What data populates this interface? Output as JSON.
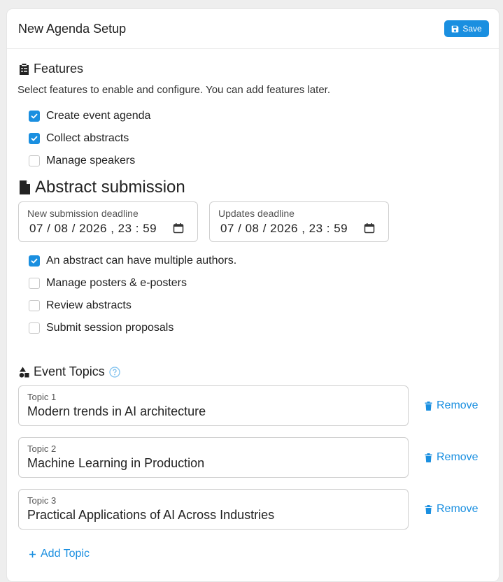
{
  "header": {
    "title": "New Agenda Setup",
    "save_label": "Save"
  },
  "features": {
    "title": "Features",
    "description": "Select features to enable and configure. You can add features later.",
    "options": [
      {
        "label": "Create event agenda",
        "checked": true
      },
      {
        "label": "Collect abstracts",
        "checked": true
      },
      {
        "label": "Manage speakers",
        "checked": false
      }
    ]
  },
  "abstract": {
    "title": "Abstract submission",
    "new_deadline": {
      "label": "New submission deadline",
      "value": "07 / 08 / 2026 ,  23 : 59"
    },
    "updates_deadline": {
      "label": "Updates deadline",
      "value": "07 / 08 / 2026 ,  23 : 59"
    },
    "options": [
      {
        "label": "An abstract can have multiple authors.",
        "checked": true
      },
      {
        "label": "Manage posters & e-posters",
        "checked": false
      },
      {
        "label": "Review abstracts",
        "checked": false
      },
      {
        "label": "Submit session proposals",
        "checked": false
      }
    ]
  },
  "topics": {
    "title": "Event Topics",
    "remove_label": "Remove",
    "add_label": "Add Topic",
    "items": [
      {
        "label": "Topic 1",
        "value": "Modern trends in AI architecture"
      },
      {
        "label": "Topic 2",
        "value": "Machine Learning in Production"
      },
      {
        "label": "Topic 3",
        "value": "Practical Applications of AI Across Industries"
      }
    ]
  },
  "colors": {
    "accent": "#1a8fe0"
  }
}
